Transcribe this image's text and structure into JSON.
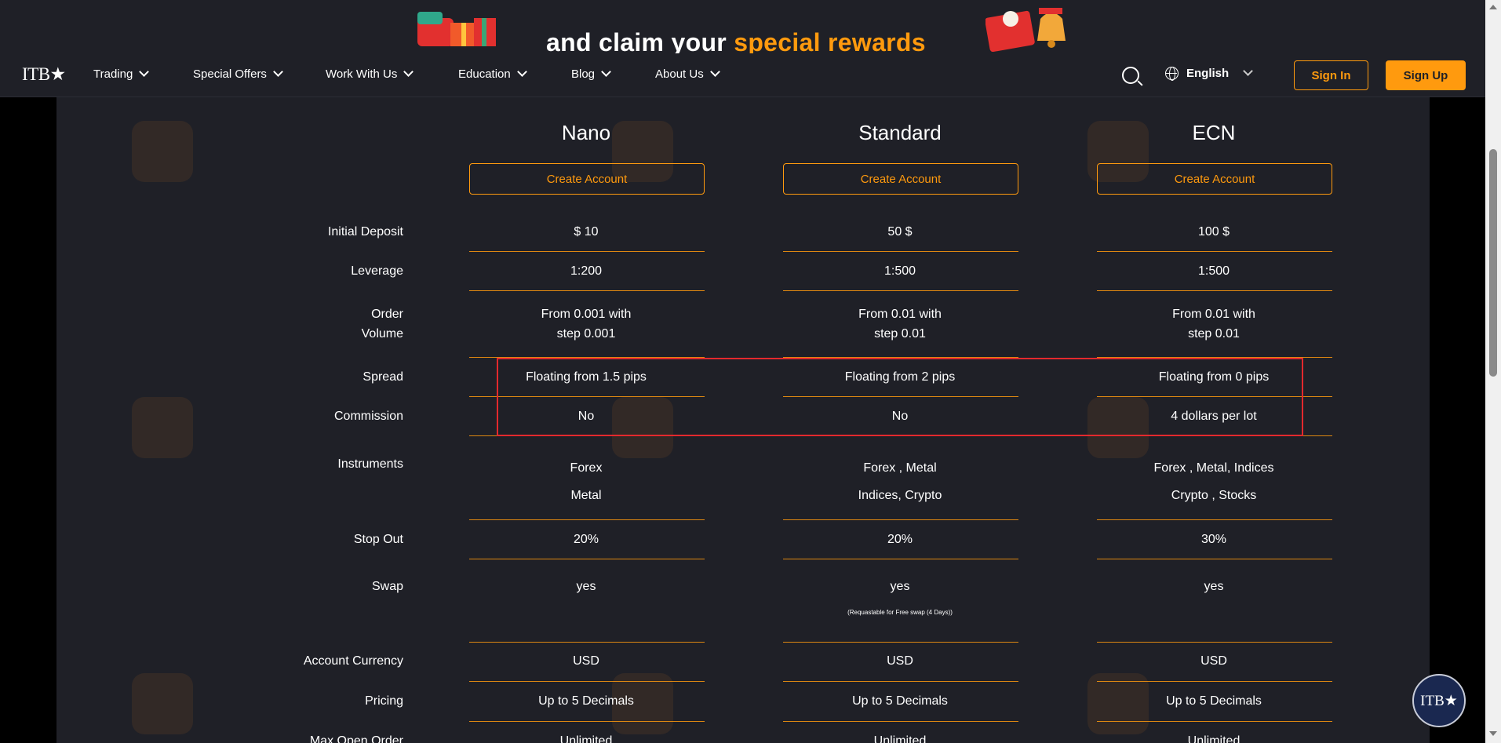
{
  "promo": {
    "text_prefix": "and claim your ",
    "text_highlight": "special rewards"
  },
  "header": {
    "logo": "ITB★",
    "nav": [
      {
        "label": "Trading"
      },
      {
        "label": "Special Offers"
      },
      {
        "label": "Work With Us"
      },
      {
        "label": "Education"
      },
      {
        "label": "Blog"
      },
      {
        "label": "About Us"
      }
    ],
    "language": "English",
    "signin_label": "Sign In",
    "signup_label": "Sign Up"
  },
  "plans": [
    {
      "name": "Nano",
      "button": "Create Account"
    },
    {
      "name": "Standard",
      "button": "Create Account"
    },
    {
      "name": "ECN",
      "button": "Create Account"
    }
  ],
  "rows": {
    "initial_deposit": {
      "label": "Initial Deposit",
      "values": [
        "$ 10",
        "50 $",
        "100 $"
      ]
    },
    "leverage": {
      "label": "Leverage",
      "values": [
        "1:200",
        "1:500",
        "1:500"
      ]
    },
    "order_volume": {
      "label_1": "Order",
      "label_2": "Volume",
      "values_1": [
        "From 0.001 with",
        "From 0.01 with",
        "From 0.01 with"
      ],
      "values_2": [
        "step 0.001",
        "step 0.01",
        "step 0.01"
      ]
    },
    "spread": {
      "label": "Spread",
      "values": [
        "Floating from 1.5 pips",
        "Floating from 2 pips",
        "Floating from 0 pips"
      ]
    },
    "commission": {
      "label": "Commission",
      "values": [
        "No",
        "No",
        "4 dollars per lot"
      ]
    },
    "instruments": {
      "label": "Instruments",
      "values_1": [
        "Forex",
        "Forex , Metal",
        "Forex , Metal, Indices"
      ],
      "values_2": [
        "Metal",
        "Indices, Crypto",
        "Crypto , Stocks"
      ]
    },
    "stop_out": {
      "label": "Stop Out",
      "values": [
        "20%",
        "20%",
        "30%"
      ]
    },
    "swap": {
      "label": "Swap",
      "values": [
        "yes",
        "yes",
        "yes"
      ],
      "note": "(Requastable for Free swap (4 Days))"
    },
    "account_currency": {
      "label": "Account Currency",
      "values": [
        "USD",
        "USD",
        "USD"
      ]
    },
    "pricing": {
      "label": "Pricing",
      "values": [
        "Up to 5 Decimals",
        "Up to 5 Decimals",
        "Up to 5 Decimals"
      ]
    },
    "max_open_order": {
      "label": "Max Open Order",
      "values": [
        "Unlimited",
        "Unlimited",
        "Unlimited"
      ]
    }
  },
  "chat_badge": "ITB★",
  "colors": {
    "accent": "#ff9a0e",
    "background": "#1f2027",
    "highlight_box": "#e3292d"
  }
}
